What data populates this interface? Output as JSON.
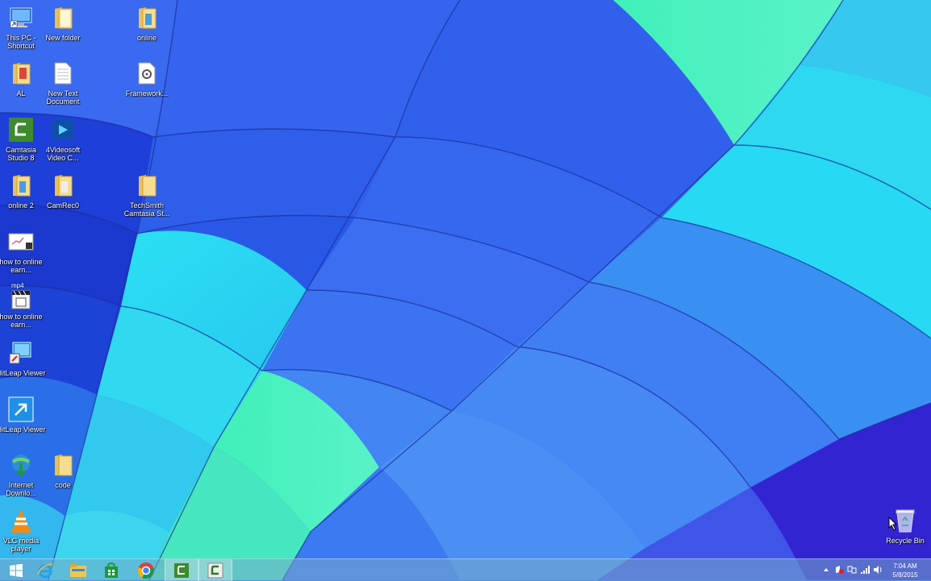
{
  "desktop": {
    "icons": [
      {
        "label": "This PC - Shortcut",
        "icon": "computer-icon"
      },
      {
        "label": "New folder",
        "icon": "folder-icon"
      },
      {
        "label": "online",
        "icon": "folder-icon"
      },
      {
        "label": "AL",
        "icon": "folder-icon"
      },
      {
        "label": "New Text Document",
        "icon": "text-document-icon"
      },
      {
        "label": "Framework...",
        "icon": "settings-file-icon"
      },
      {
        "label": "Camtasia Studio 8",
        "icon": "camtasia-icon"
      },
      {
        "label": "4Videosoft Video C...",
        "icon": "video-converter-icon"
      },
      {
        "label": "online 2",
        "icon": "folder-icon"
      },
      {
        "label": "CamRec0",
        "icon": "folder-icon"
      },
      {
        "label": "TechSmith Camtasia St...",
        "icon": "folder-icon"
      },
      {
        "label": "how to online earn...",
        "icon": "video-file-icon"
      },
      {
        "label": "how to online earn...",
        "icon": "mp4-file-icon",
        "badge": "mp4"
      },
      {
        "label": "HitLeap Viewer",
        "icon": "hitleap-icon"
      },
      {
        "label": "HitLeap Viewer",
        "icon": "shortcut-icon"
      },
      {
        "label": "Internet Downlo...",
        "icon": "internet-download-icon"
      },
      {
        "label": "code",
        "icon": "folder-icon"
      },
      {
        "label": "VLC media player",
        "icon": "vlc-icon"
      },
      {
        "label": "Recycle Bin",
        "icon": "recycle-bin-icon"
      }
    ]
  },
  "taskbar": {
    "buttons": [
      {
        "name": "start",
        "icon": "windows-start-icon"
      },
      {
        "name": "internet-explorer",
        "icon": "ie-icon"
      },
      {
        "name": "file-explorer",
        "icon": "file-explorer-icon"
      },
      {
        "name": "store",
        "icon": "store-icon"
      },
      {
        "name": "chrome",
        "icon": "chrome-icon"
      },
      {
        "name": "camtasia",
        "icon": "camtasia-icon"
      },
      {
        "name": "camtasia-recorder",
        "icon": "camtasia-recorder-icon"
      }
    ],
    "tray": {
      "icons": [
        "show-hidden-icons-icon",
        "action-center-icon",
        "network-icon",
        "signal-icon",
        "volume-icon"
      ],
      "time": "7:04 AM",
      "date": "5/8/2015"
    }
  },
  "colors": {
    "deep_blue": "#1d3fd8",
    "mid_blue": "#3b6ff0",
    "sky_blue": "#4f9ef5",
    "cyan": "#2fe6f0",
    "mint": "#3ff2b0",
    "violet": "#3a22d6"
  }
}
